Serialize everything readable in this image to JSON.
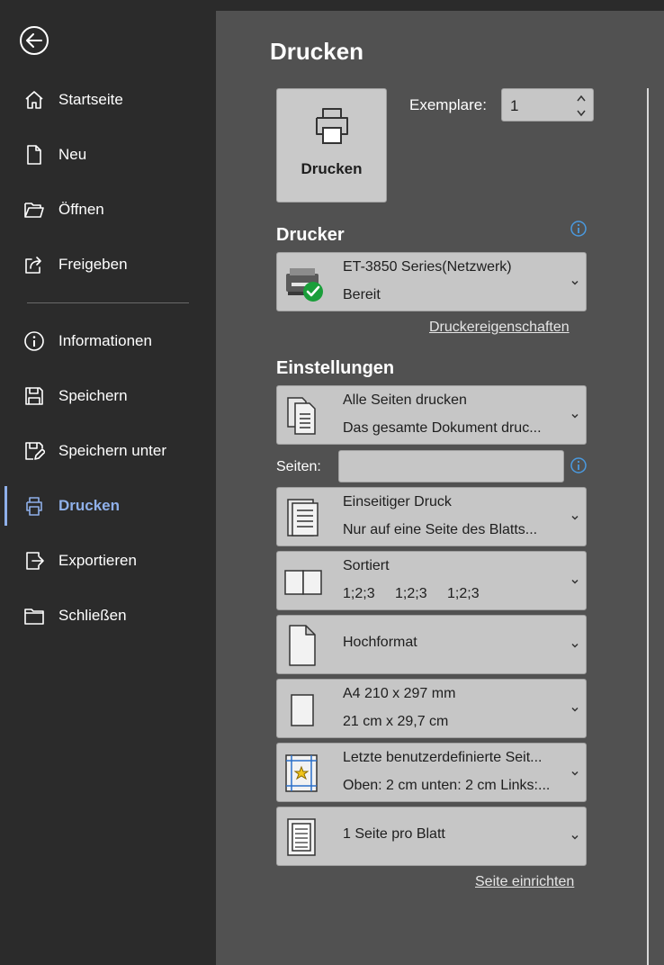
{
  "backstage": {
    "back_icon": "back-arrow-icon",
    "nav": [
      {
        "label": "Startseite",
        "icon": "home-icon"
      },
      {
        "label": "Neu",
        "icon": "new-document-icon"
      },
      {
        "label": "Öffnen",
        "icon": "folder-open-icon"
      },
      {
        "label": "Freigeben",
        "icon": "share-icon"
      },
      {
        "label": "Informationen",
        "icon": "info-icon"
      },
      {
        "label": "Speichern",
        "icon": "save-icon"
      },
      {
        "label": "Speichern unter",
        "icon": "save-as-icon"
      },
      {
        "label": "Drucken",
        "icon": "printer-icon",
        "active": true
      },
      {
        "label": "Exportieren",
        "icon": "export-icon"
      },
      {
        "label": "Schließen",
        "icon": "close-folder-icon"
      }
    ]
  },
  "print": {
    "title": "Drucken",
    "print_button_label": "Drucken",
    "copies_label": "Exemplare:",
    "copies_value": "1",
    "printer_section_title": "Drucker",
    "printer": {
      "name": "ET-3850 Series(Netzwerk)",
      "status": "Bereit"
    },
    "printer_properties_link": "Druckereigenschaften",
    "settings_section_title": "Einstellungen",
    "pages_label": "Seiten:",
    "pages_value": "",
    "settings": {
      "range": {
        "line1": "Alle Seiten drucken",
        "line2": "Das gesamte Dokument druc..."
      },
      "sides": {
        "line1": "Einseitiger Druck",
        "line2": "Nur auf eine Seite des Blatts..."
      },
      "collate": {
        "line1": "Sortiert",
        "line2": [
          "1;2;3",
          "1;2;3",
          "1;2;3"
        ]
      },
      "orientation": {
        "line1": "Hochformat"
      },
      "paper": {
        "line1": "A4 210 x 297 mm",
        "line2": "21 cm x 29,7 cm"
      },
      "margins": {
        "line1": "Letzte benutzerdefinierte Seit...",
        "line2": "Oben: 2 cm unten: 2 cm Links:..."
      },
      "per_sheet": {
        "line1": "1 Seite pro Blatt"
      }
    },
    "page_setup_link": "Seite einrichten"
  },
  "colors": {
    "sidebar_bg": "#2b2b2b",
    "main_bg": "#515151",
    "accent": "#8fb0ea",
    "control_bg": "#c6c6c6",
    "info_blue": "#4a9ae0",
    "ready_green": "#1a9e3a"
  }
}
